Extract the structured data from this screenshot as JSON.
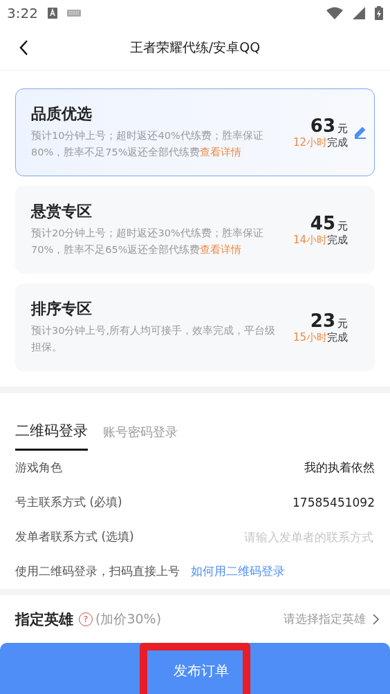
{
  "status_bar": {
    "time": "3:22"
  },
  "header": {
    "title": "王者荣耀代练/安卓QQ"
  },
  "plans": [
    {
      "name": "品质优选",
      "description": "预计10分钟上号；超时返还40%代练费；胜率保证80%，胜率不足75%返还全部代练费",
      "link": "查看详情",
      "price": "63",
      "unit": "元",
      "hours": "12小时",
      "done": "完成",
      "selected": true
    },
    {
      "name": "悬赏专区",
      "description": "预计20分钟上号；超时返还30%代练费；胜率保证70%，胜率不足65%返还全部代练费",
      "link": "查看详情",
      "price": "45",
      "unit": "元",
      "hours": "14小时",
      "done": "完成",
      "selected": false
    },
    {
      "name": "排序专区",
      "description": "预计30分钟上号,所有人均可接手，效率完成，平台级担保。",
      "price": "23",
      "unit": "元",
      "hours": "15小时",
      "done": "完成",
      "selected": false
    }
  ],
  "login_tabs": [
    {
      "label": "二维码登录",
      "selected": true
    },
    {
      "label": "账号密码登录",
      "selected": false
    }
  ],
  "fields": [
    {
      "label": "游戏角色",
      "kind": "value",
      "value": "我的执着依然"
    },
    {
      "label": "号主联系方式",
      "note": "(必填)",
      "kind": "value",
      "value": "17585451092"
    },
    {
      "label": "发单者联系方式",
      "note": "(选填)",
      "kind": "input",
      "placeholder": "请输入发单者的联系方式"
    }
  ],
  "qr_hint": {
    "text": "使用二维码登录，扫码直接上号",
    "link": "如何用二维码登录"
  },
  "hero": {
    "label": "指定英雄",
    "help": "?",
    "note": "(加价30%)",
    "placeholder": "请选择指定英雄"
  },
  "submit": {
    "label": "发布订单",
    "highlighted": true
  }
}
